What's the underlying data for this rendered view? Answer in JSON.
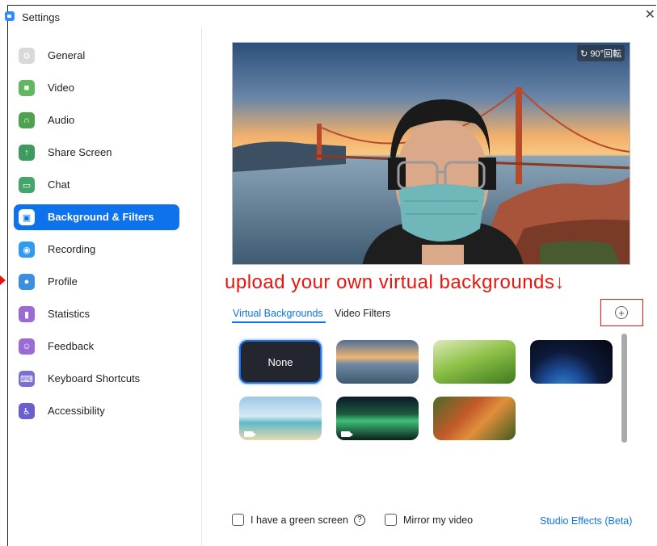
{
  "window": {
    "title": "Settings"
  },
  "colors": {
    "accent": "#0e72ed",
    "annotation": "#e8150f"
  },
  "sidebar": {
    "items": [
      {
        "label": "General",
        "icon": "gear-icon",
        "color": "#d9d9d9",
        "active": false
      },
      {
        "label": "Video",
        "icon": "camera-icon",
        "color": "#5fb85f",
        "active": false
      },
      {
        "label": "Audio",
        "icon": "headphones-icon",
        "color": "#4ea44e",
        "active": false
      },
      {
        "label": "Share Screen",
        "icon": "share-screen-icon",
        "color": "#3e9b5d",
        "active": false
      },
      {
        "label": "Chat",
        "icon": "chat-bubble-icon",
        "color": "#44a56a",
        "active": false
      },
      {
        "label": "Background & Filters",
        "icon": "person-card-icon",
        "color": "#ffffff",
        "active": true
      },
      {
        "label": "Recording",
        "icon": "record-icon",
        "color": "#2d9cf0",
        "active": false
      },
      {
        "label": "Profile",
        "icon": "person-icon",
        "color": "#3a8fe0",
        "active": false
      },
      {
        "label": "Statistics",
        "icon": "bar-chart-icon",
        "color": "#9b6ad6",
        "active": false
      },
      {
        "label": "Feedback",
        "icon": "smile-icon",
        "color": "#9b6ad6",
        "active": false
      },
      {
        "label": "Keyboard Shortcuts",
        "icon": "keyboard-icon",
        "color": "#7a6fd6",
        "active": false
      },
      {
        "label": "Accessibility",
        "icon": "accessibility-icon",
        "color": "#6a5fd0",
        "active": false
      }
    ]
  },
  "preview": {
    "rotate_label": "90°回転"
  },
  "annotation": {
    "text": "upload your own virtual backgrounds↓"
  },
  "tabs": [
    {
      "label": "Virtual Backgrounds",
      "active": true
    },
    {
      "label": "Video Filters",
      "active": false
    }
  ],
  "add_button": {
    "symbol": "+"
  },
  "backgrounds": [
    {
      "label": "None",
      "kind": "none",
      "selected": true
    },
    {
      "label": "",
      "kind": "golden-gate",
      "selected": false,
      "video": false
    },
    {
      "label": "",
      "kind": "grass",
      "selected": false,
      "video": false
    },
    {
      "label": "",
      "kind": "earth",
      "selected": false,
      "video": false
    },
    {
      "label": "",
      "kind": "beach",
      "selected": false,
      "video": true
    },
    {
      "label": "",
      "kind": "aurora",
      "selected": false,
      "video": true
    },
    {
      "label": "",
      "kind": "autumn",
      "selected": false,
      "video": false
    }
  ],
  "footer": {
    "green_screen_label": "I have a green screen",
    "help_symbol": "?",
    "mirror_label": "Mirror my video",
    "studio_effects_label": "Studio Effects (Beta)"
  }
}
